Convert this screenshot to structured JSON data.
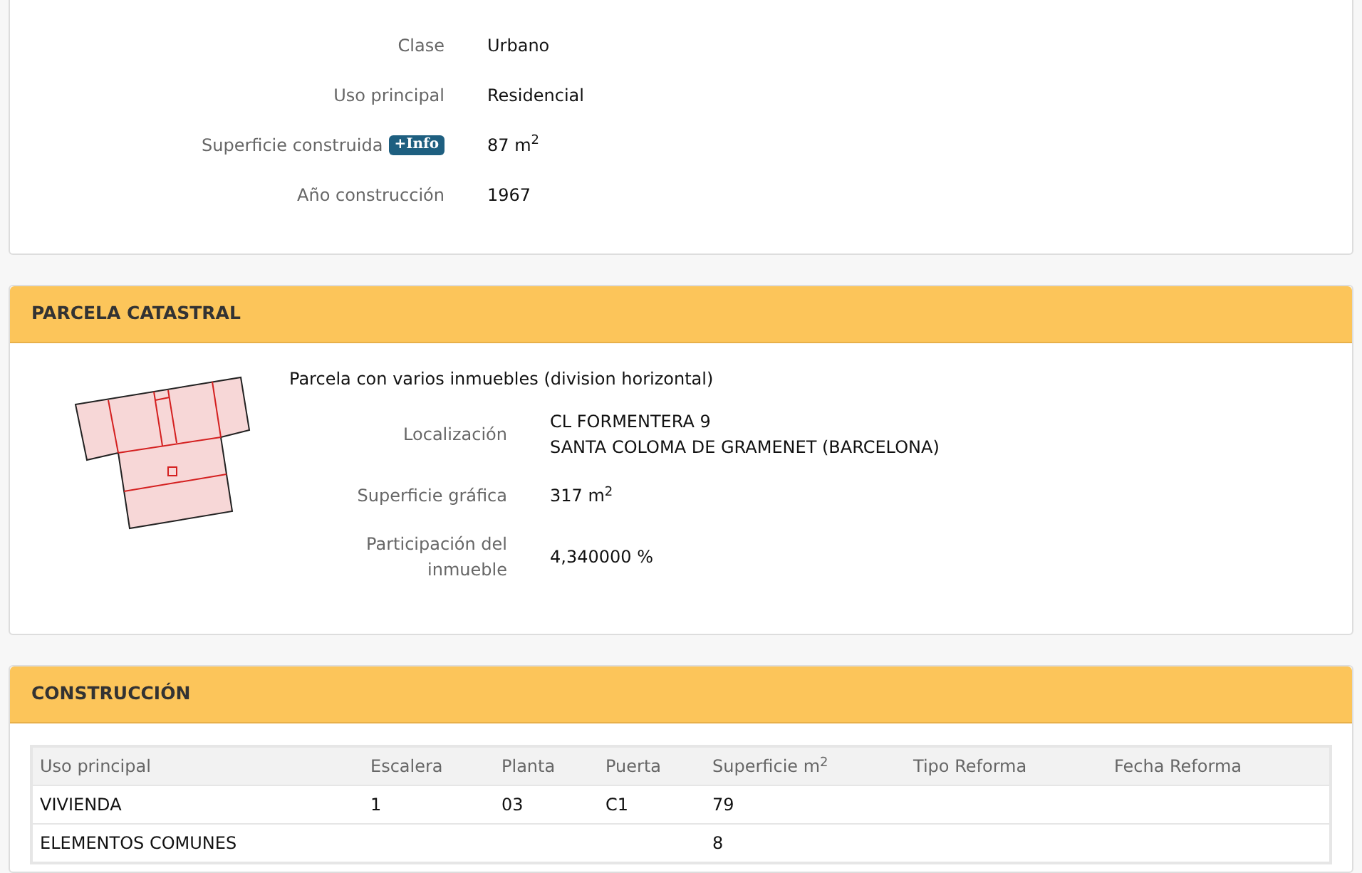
{
  "inmueble": {
    "rows": [
      {
        "label": "Clase",
        "value": "Urbano"
      },
      {
        "label": "Uso principal",
        "value": "Residencial"
      },
      {
        "label": "Superficie construida",
        "badge": "+Info",
        "value": "87 m$^{2}$"
      },
      {
        "label": "Año construcción",
        "value": "1967"
      }
    ]
  },
  "parcela": {
    "title": "PARCELA CATASTRAL",
    "description": "Parcela con varios inmuebles (division horizontal)",
    "rows": [
      {
        "label": "Localización",
        "lines": [
          "CL FORMENTERA 9",
          "SANTA COLOMA DE GRAMENET (BARCELONA)"
        ]
      },
      {
        "label": "Superficie gráfica",
        "lines": [
          "317 m$^{2}$"
        ]
      },
      {
        "label": "Participación del inmueble",
        "lines": [
          "4,340000 %"
        ]
      }
    ]
  },
  "construccion": {
    "title": "CONSTRUCCIÓN",
    "table": {
      "columns": [
        "Uso principal",
        "Escalera",
        "Planta",
        "Puerta",
        "Superficie m$^{2}$",
        "Tipo Reforma",
        "Fecha Reforma"
      ],
      "rows": [
        [
          "VIVIENDA",
          "1",
          "03",
          "C1",
          "79",
          "",
          ""
        ],
        [
          "ELEMENTOS COMUNES",
          "",
          "",
          "",
          "8",
          "",
          ""
        ]
      ]
    }
  }
}
